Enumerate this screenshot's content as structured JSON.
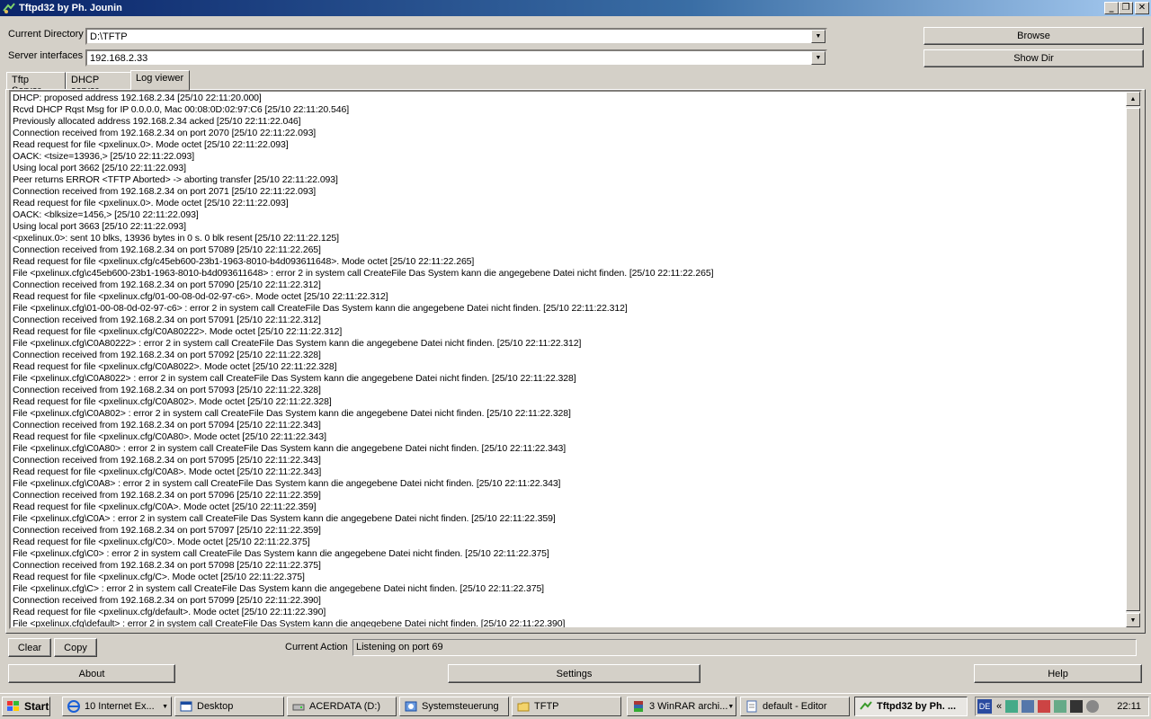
{
  "window": {
    "title": "Tftpd32 by Ph. Jounin"
  },
  "form": {
    "current_directory_label": "Current Directory",
    "current_directory_value": "D:\\TFTP",
    "server_interfaces_label": "Server interfaces",
    "server_interfaces_value": "192.168.2.33",
    "browse_label": "Browse",
    "showdir_label": "Show Dir"
  },
  "tabs": [
    {
      "label": "Tftp Server"
    },
    {
      "label": "DHCP server"
    },
    {
      "label": "Log viewer"
    }
  ],
  "log": [
    "DHCP: proposed address 192.168.2.34 [25/10 22:11:20.000]",
    "Rcvd DHCP Rqst Msg for IP 0.0.0.0, Mac 00:08:0D:02:97:C6 [25/10 22:11:20.546]",
    "Previously allocated address 192.168.2.34 acked [25/10 22:11:22.046]",
    "Connection received from 192.168.2.34 on port 2070 [25/10 22:11:22.093]",
    "Read request for file <pxelinux.0>. Mode octet [25/10 22:11:22.093]",
    "OACK: <tsize=13936,> [25/10 22:11:22.093]",
    "Using local port 3662 [25/10 22:11:22.093]",
    "Peer returns ERROR <TFTP Aborted> -> aborting transfer [25/10 22:11:22.093]",
    "Connection received from 192.168.2.34 on port 2071 [25/10 22:11:22.093]",
    "Read request for file <pxelinux.0>. Mode octet [25/10 22:11:22.093]",
    "OACK: <blksize=1456,> [25/10 22:11:22.093]",
    "Using local port 3663 [25/10 22:11:22.093]",
    "<pxelinux.0>: sent 10 blks, 13936 bytes in 0 s. 0 blk resent [25/10 22:11:22.125]",
    "Connection received from 192.168.2.34 on port 57089 [25/10 22:11:22.265]",
    "Read request for file <pxelinux.cfg/c45eb600-23b1-1963-8010-b4d093611648>. Mode octet [25/10 22:11:22.265]",
    "File <pxelinux.cfg\\c45eb600-23b1-1963-8010-b4d093611648> : error 2 in system call CreateFile Das System kann die angegebene Datei nicht finden. [25/10 22:11:22.265]",
    "Connection received from 192.168.2.34 on port 57090 [25/10 22:11:22.312]",
    "Read request for file <pxelinux.cfg/01-00-08-0d-02-97-c6>. Mode octet [25/10 22:11:22.312]",
    "File <pxelinux.cfg\\01-00-08-0d-02-97-c6> : error 2 in system call CreateFile Das System kann die angegebene Datei nicht finden. [25/10 22:11:22.312]",
    "Connection received from 192.168.2.34 on port 57091 [25/10 22:11:22.312]",
    "Read request for file <pxelinux.cfg/C0A80222>. Mode octet [25/10 22:11:22.312]",
    "File <pxelinux.cfg\\C0A80222> : error 2 in system call CreateFile Das System kann die angegebene Datei nicht finden. [25/10 22:11:22.312]",
    "Connection received from 192.168.2.34 on port 57092 [25/10 22:11:22.328]",
    "Read request for file <pxelinux.cfg/C0A8022>. Mode octet [25/10 22:11:22.328]",
    "File <pxelinux.cfg\\C0A8022> : error 2 in system call CreateFile Das System kann die angegebene Datei nicht finden. [25/10 22:11:22.328]",
    "Connection received from 192.168.2.34 on port 57093 [25/10 22:11:22.328]",
    "Read request for file <pxelinux.cfg/C0A802>. Mode octet [25/10 22:11:22.328]",
    "File <pxelinux.cfg\\C0A802> : error 2 in system call CreateFile Das System kann die angegebene Datei nicht finden. [25/10 22:11:22.328]",
    "Connection received from 192.168.2.34 on port 57094 [25/10 22:11:22.343]",
    "Read request for file <pxelinux.cfg/C0A80>. Mode octet [25/10 22:11:22.343]",
    "File <pxelinux.cfg\\C0A80> : error 2 in system call CreateFile Das System kann die angegebene Datei nicht finden. [25/10 22:11:22.343]",
    "Connection received from 192.168.2.34 on port 57095 [25/10 22:11:22.343]",
    "Read request for file <pxelinux.cfg/C0A8>. Mode octet [25/10 22:11:22.343]",
    "File <pxelinux.cfg\\C0A8> : error 2 in system call CreateFile Das System kann die angegebene Datei nicht finden. [25/10 22:11:22.343]",
    "Connection received from 192.168.2.34 on port 57096 [25/10 22:11:22.359]",
    "Read request for file <pxelinux.cfg/C0A>. Mode octet [25/10 22:11:22.359]",
    "File <pxelinux.cfg\\C0A> : error 2 in system call CreateFile Das System kann die angegebene Datei nicht finden. [25/10 22:11:22.359]",
    "Connection received from 192.168.2.34 on port 57097 [25/10 22:11:22.359]",
    "Read request for file <pxelinux.cfg/C0>. Mode octet [25/10 22:11:22.375]",
    "File <pxelinux.cfg\\C0> : error 2 in system call CreateFile Das System kann die angegebene Datei nicht finden. [25/10 22:11:22.375]",
    "Connection received from 192.168.2.34 on port 57098 [25/10 22:11:22.375]",
    "Read request for file <pxelinux.cfg/C>. Mode octet [25/10 22:11:22.375]",
    "File <pxelinux.cfg\\C> : error 2 in system call CreateFile Das System kann die angegebene Datei nicht finden. [25/10 22:11:22.375]",
    "Connection received from 192.168.2.34 on port 57099 [25/10 22:11:22.390]",
    "Read request for file <pxelinux.cfg/default>. Mode octet [25/10 22:11:22.390]",
    "File <pxelinux.cfg\\default> : error 2 in system call CreateFile Das System kann die angegebene Datei nicht finden. [25/10 22:11:22.390]"
  ],
  "actions": {
    "clear_label": "Clear",
    "copy_label": "Copy",
    "current_action_label": "Current Action",
    "current_action_value": "Listening on port 69"
  },
  "footer": {
    "about_label": "About",
    "settings_label": "Settings",
    "help_label": "Help"
  },
  "taskbar": {
    "start_label": "Start",
    "tasks": [
      {
        "label": "10 Internet Ex...",
        "icon": "internet-explorer-icon"
      },
      {
        "label": "Desktop",
        "icon": "explorer-window-icon"
      },
      {
        "label": "ACERDATA (D:)",
        "icon": "drive-icon"
      },
      {
        "label": "Systemsteuerung",
        "icon": "control-panel-icon"
      },
      {
        "label": "TFTP",
        "icon": "folder-icon"
      },
      {
        "label": "3 WinRAR archi...",
        "icon": "winrar-icon"
      },
      {
        "label": "default - Editor",
        "icon": "notepad-icon"
      },
      {
        "label": "Tftpd32 by Ph. ...",
        "icon": "tftpd32-icon"
      }
    ],
    "language": "DE",
    "clock": "22:11"
  }
}
